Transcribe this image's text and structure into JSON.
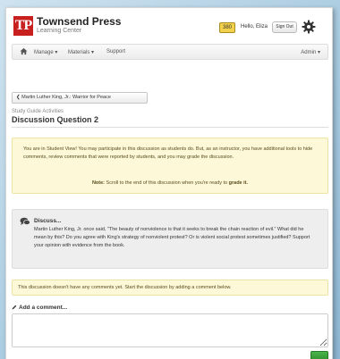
{
  "brand": {
    "logo": "TP",
    "name": "Townsend Press",
    "subtitle": "Learning Center"
  },
  "header": {
    "points": "380",
    "greeting": "Hello, Eliza",
    "sign_out": "Sign Out",
    "settings_icon": "gear-icon"
  },
  "nav": {
    "home_icon": "home-icon",
    "manage": "Manage",
    "materials": "Materials",
    "support": "Support",
    "admin": "Admin"
  },
  "page": {
    "back_label": "Martin Luther King, Jr.: Warrior for Peace",
    "section": "Study Guide Activities",
    "title": "Discussion Question 2"
  },
  "notice": {
    "text": "You are in Student View! You may participate in this discussion as students do. But, as an instructor, you have additional tools to hide comments, review comments that were reported by students, and you may grade the discussion.",
    "note_prefix": "Note:",
    "note_text": "Scroll to the end of this discussion when you're ready to",
    "note_bold": "grade it."
  },
  "discuss": {
    "title": "Discuss...",
    "body": "Martin Luther King, Jr. once said, \"The beauty of nonviolence is that it seeks to break the chain reaction of evil.\" What did he mean by this? Do you agree with King's strategy of nonviolent protest? Or is violent social protest sometimes justified? Support your opinion with evidence from the book."
  },
  "empty_notice": "This discussion doesn't have any comments yet. Start the discussion by adding a comment below.",
  "comment": {
    "label": "Add a comment...",
    "value": ""
  },
  "colors": {
    "logo_red": "#c8201f",
    "notice_bg": "#fcf8d8",
    "post_green": "#3aa23a"
  }
}
